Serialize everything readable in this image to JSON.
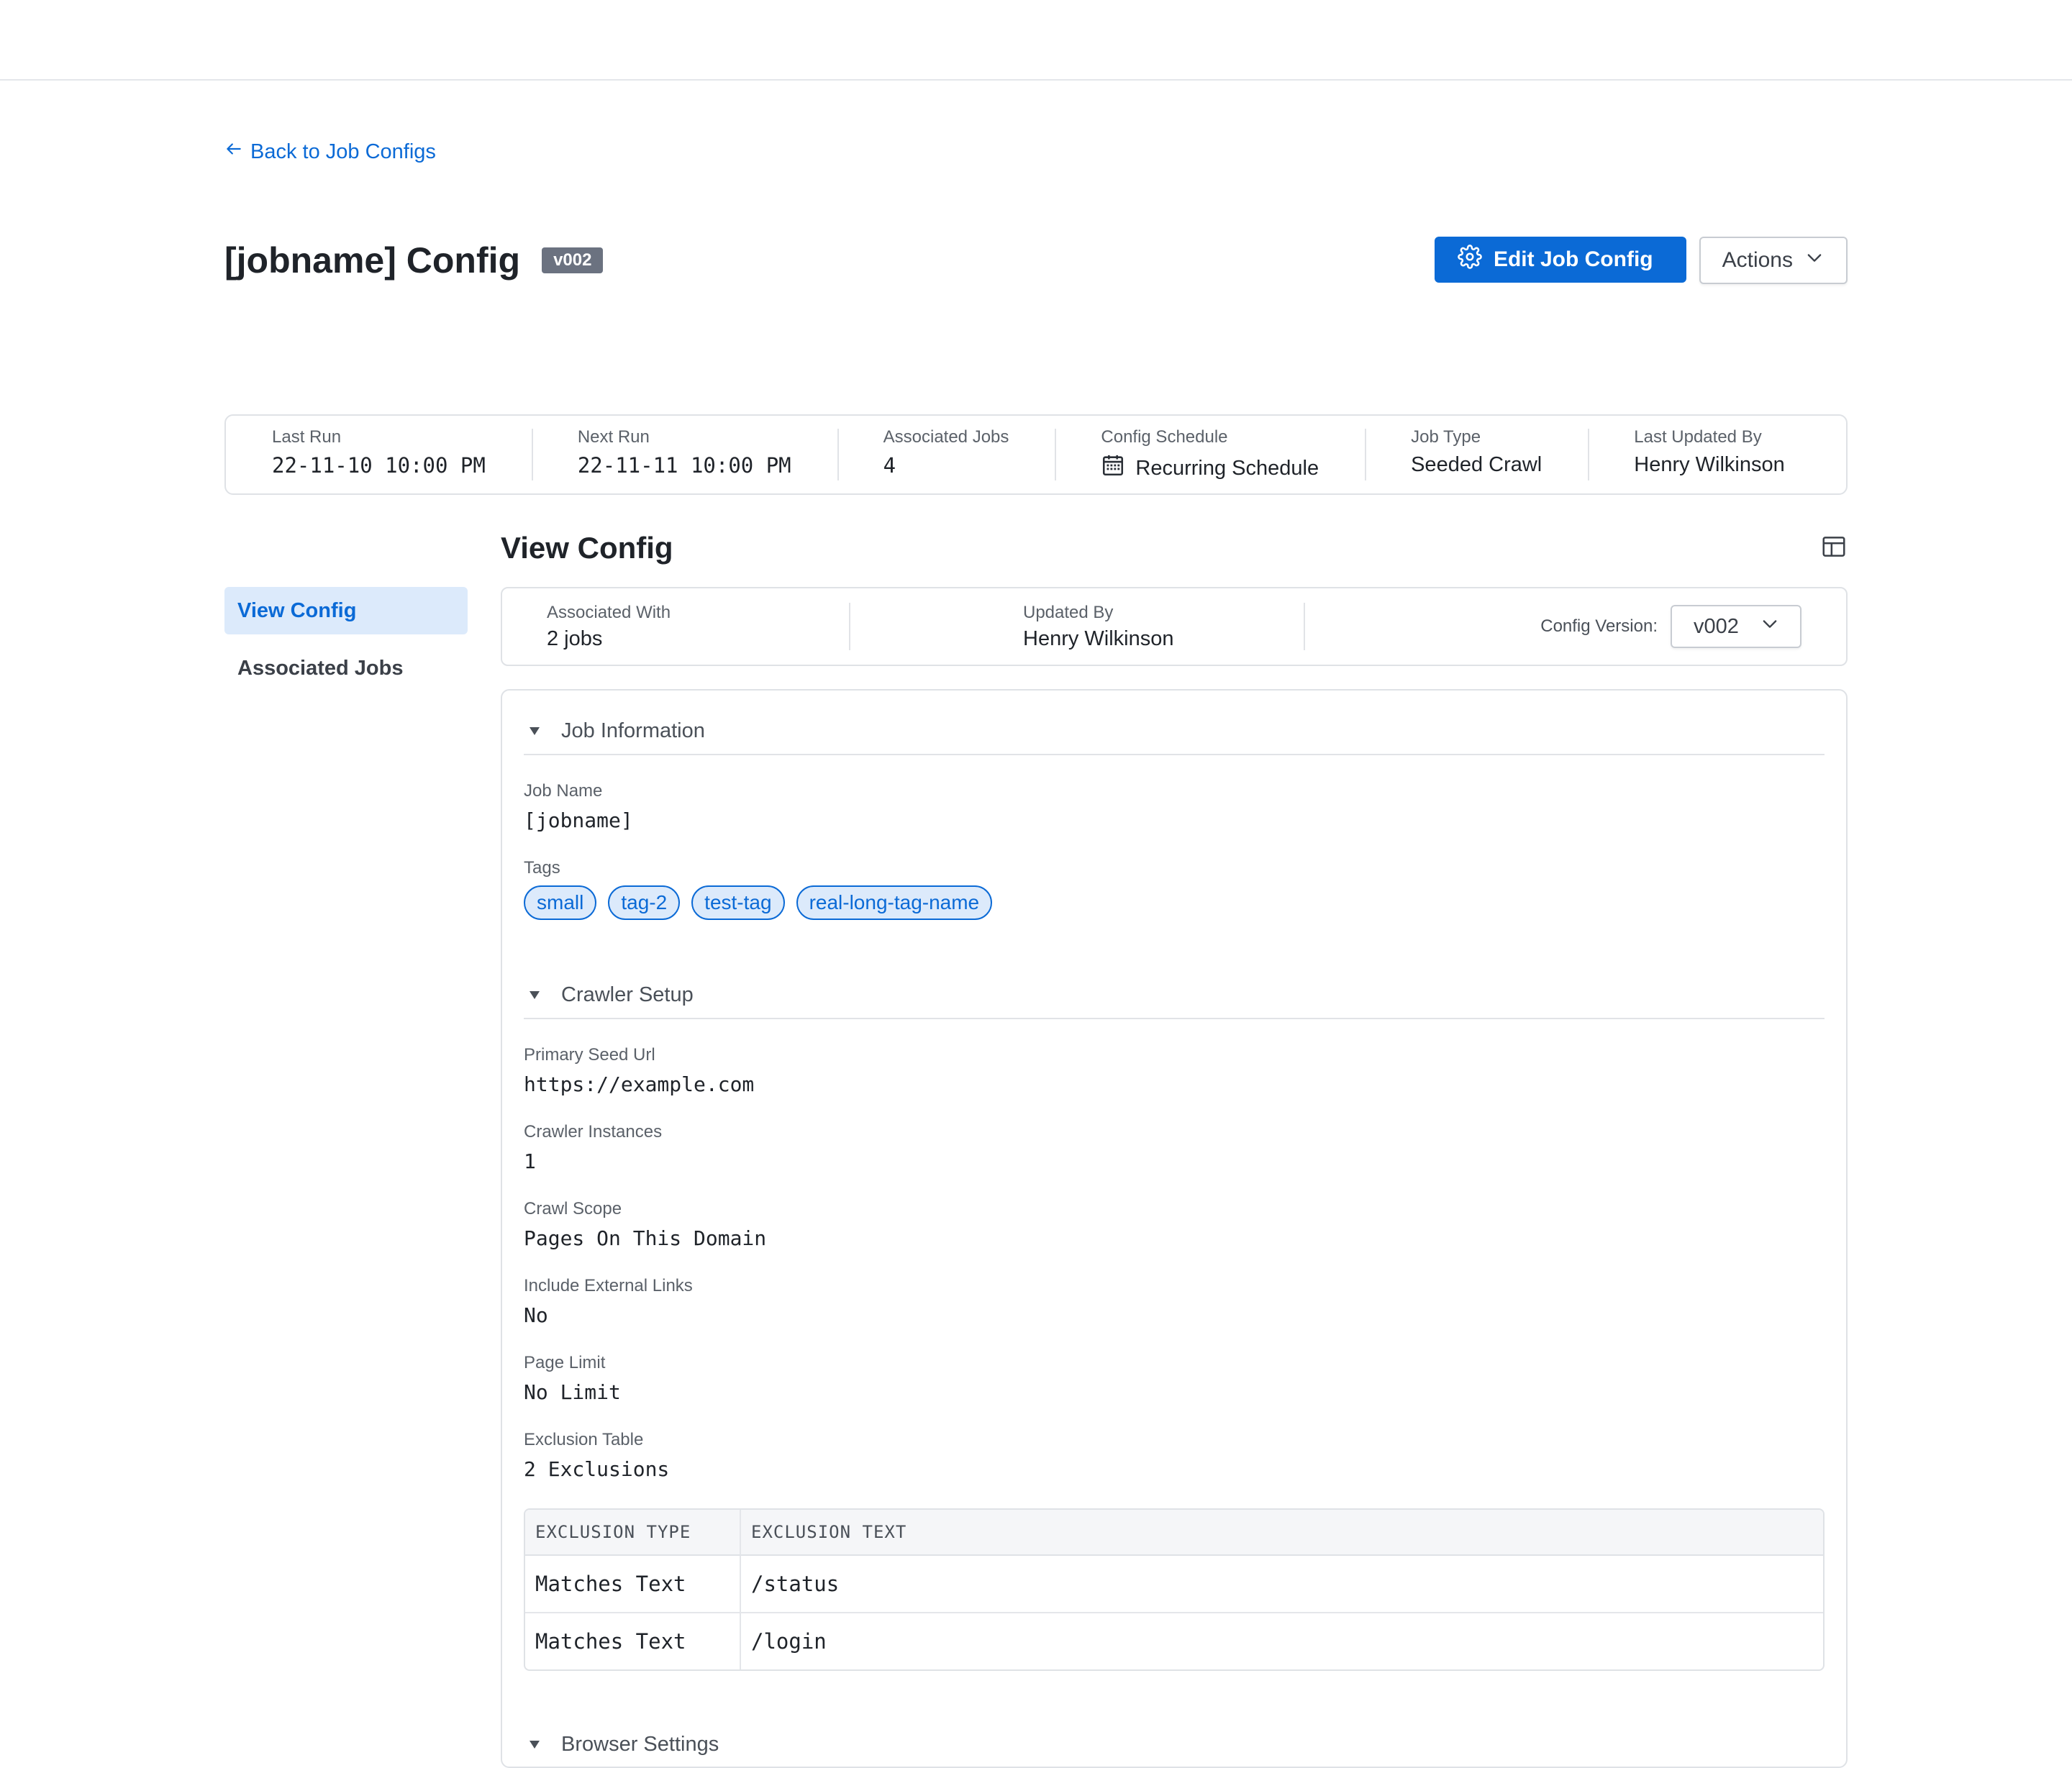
{
  "back_link": {
    "label": "Back to Job Configs"
  },
  "header": {
    "title": "[jobname] Config",
    "version_badge": "v002",
    "edit_button": "Edit Job Config",
    "actions_button": "Actions"
  },
  "stats": [
    {
      "label": "Last Run",
      "value": "22-11-10 10:00 PM"
    },
    {
      "label": "Next Run",
      "value": "22-11-11 10:00 PM"
    },
    {
      "label": "Associated Jobs",
      "value": "4"
    },
    {
      "label": "Config Schedule",
      "value": "Recurring Schedule",
      "icon": "calendar-icon"
    },
    {
      "label": "Job Type",
      "value": "Seeded Crawl"
    },
    {
      "label": "Last Updated By",
      "value": "Henry Wilkinson"
    }
  ],
  "sidebar": {
    "items": [
      {
        "label": "View Config",
        "active": true
      },
      {
        "label": "Associated Jobs",
        "active": false
      }
    ]
  },
  "main": {
    "title": "View Config",
    "associated_with": {
      "label": "Associated With",
      "value": "2 jobs"
    },
    "updated_by": {
      "label": "Updated By",
      "value": "Henry Wilkinson"
    },
    "config_version": {
      "label": "Config Version:",
      "selected": "v002"
    }
  },
  "job_information": {
    "heading": "Job Information",
    "job_name": {
      "label": "Job Name",
      "value": "[jobname]"
    },
    "tags": {
      "label": "Tags",
      "values": [
        "small",
        "tag-2",
        "test-tag",
        "real-long-tag-name"
      ]
    }
  },
  "crawler_setup": {
    "heading": "Crawler Setup",
    "fields": [
      {
        "label": "Primary Seed Url",
        "value": "https://example.com"
      },
      {
        "label": "Crawler Instances",
        "value": "1"
      },
      {
        "label": "Crawl Scope",
        "value": "Pages On This Domain"
      },
      {
        "label": "Include External Links",
        "value": "No"
      },
      {
        "label": "Page Limit",
        "value": "No Limit"
      },
      {
        "label": "Exclusion Table",
        "value": "2 Exclusions"
      }
    ],
    "exclusion_table": {
      "headers": [
        "EXCLUSION TYPE",
        "EXCLUSION TEXT"
      ],
      "rows": [
        [
          "Matches Text",
          "/status"
        ],
        [
          "Matches Text",
          "/login"
        ]
      ]
    }
  },
  "browser_settings": {
    "heading": "Browser Settings"
  },
  "colors": {
    "accent": "#0b6ad6",
    "accent_light": "#dceafb",
    "badge": "#6b7280",
    "border": "#dfe2e6"
  }
}
